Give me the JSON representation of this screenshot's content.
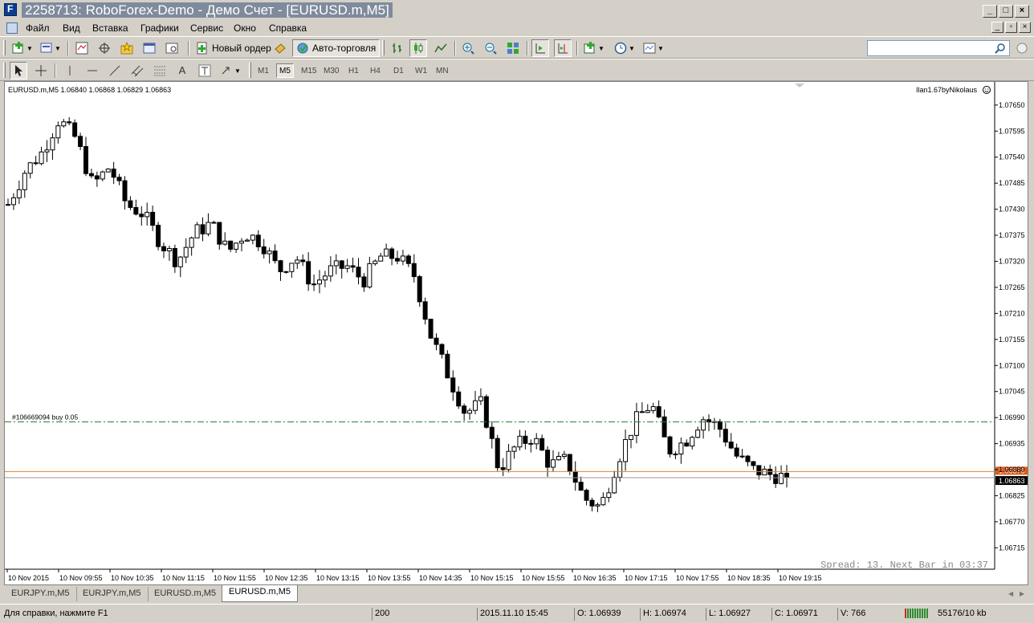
{
  "window": {
    "title": "2258713: RoboForex-Demo - Демо Счет - [EURUSD.m,M5]",
    "controls": [
      "_",
      "□",
      "×"
    ],
    "mdi_controls": [
      "_",
      "▫",
      "×"
    ]
  },
  "menu": {
    "items": [
      "Файл",
      "Вид",
      "Вставка",
      "Графики",
      "Сервис",
      "Окно",
      "Справка"
    ]
  },
  "toolbar": {
    "new_order_label": "Новый ордер",
    "autotrading_label": "Авто-торговля",
    "search_placeholder": ""
  },
  "timeframes": [
    "M1",
    "M5",
    "M15",
    "M30",
    "H1",
    "H4",
    "D1",
    "W1",
    "MN"
  ],
  "active_timeframe": "M5",
  "chart": {
    "symbol_info": "EURUSD.m,M5  1.06840 1.06868 1.06829 1.06863",
    "expert_label": "Ilan1.67byNikolaus",
    "order_label": "#106669094 buy 0.05",
    "spread_text": "Spread: 13. Next Bar in 03:37",
    "bid_label": "1.06863",
    "ask_label": "1.06876",
    "colors": {
      "bull_candle": "#ffffff",
      "bear_candle": "#000000",
      "order_line": "#2e7d32",
      "ask_line": "#e08030",
      "bid_line": "#9a9a9a",
      "ask_tag": "#e05a1a",
      "bid_tag": "#000000"
    }
  },
  "chart_data": {
    "type": "candlestick",
    "y_ticks": [
      "1.07650",
      "1.07595",
      "1.07540",
      "1.07485",
      "1.07430",
      "1.07375",
      "1.07320",
      "1.07265",
      "1.07210",
      "1.07155",
      "1.07100",
      "1.07045",
      "1.06990",
      "1.06935",
      "1.06880",
      "1.06825",
      "1.06770",
      "1.06715"
    ],
    "x_ticks": [
      "10 Nov 2015",
      "10 Nov 09:55",
      "10 Nov 10:35",
      "10 Nov 11:15",
      "10 Nov 11:55",
      "10 Nov 12:35",
      "10 Nov 13:15",
      "10 Nov 13:55",
      "10 Nov 14:35",
      "10 Nov 15:15",
      "10 Nov 15:55",
      "10 Nov 16:35",
      "10 Nov 17:15",
      "10 Nov 17:55",
      "10 Nov 18:35",
      "10 Nov 19:15"
    ],
    "ylim": [
      1.06702,
      1.07665
    ],
    "order_price": 1.06981,
    "ask_price": 1.06876,
    "bid_price": 1.06863,
    "close_path": [
      1.0744,
      1.0751,
      1.0755,
      1.0762,
      1.0758,
      1.0748,
      1.0752,
      1.0744,
      1.0742,
      1.0736,
      1.0732,
      1.0738,
      1.074,
      1.0734,
      1.0738,
      1.0736,
      1.073,
      1.0733,
      1.0727,
      1.073,
      1.0731,
      1.0728,
      1.0733,
      1.0733,
      1.0729,
      1.0716,
      1.0708,
      1.07,
      1.0702,
      1.0688,
      1.0693,
      1.0695,
      1.0689,
      1.069,
      1.0682,
      1.068,
      1.069,
      1.0698,
      1.0702,
      1.0692,
      1.0694,
      1.0699,
      1.0697,
      1.0691,
      1.0688,
      1.0687,
      1.06863
    ]
  },
  "tabs": [
    "EURJPY.m,M5",
    "EURJPY.m,M5",
    "EURUSD.m,M5",
    "EURUSD.m,M5"
  ],
  "active_tab": 3,
  "status": {
    "help": "Для справки, нажмите F1",
    "profile": "200",
    "datetime": "2015.11.10 15:45",
    "open": "O: 1.06939",
    "high": "H: 1.06974",
    "low": "L: 1.06927",
    "close": "C: 1.06971",
    "volume": "V: 766",
    "traffic": "55176/10 kb"
  }
}
